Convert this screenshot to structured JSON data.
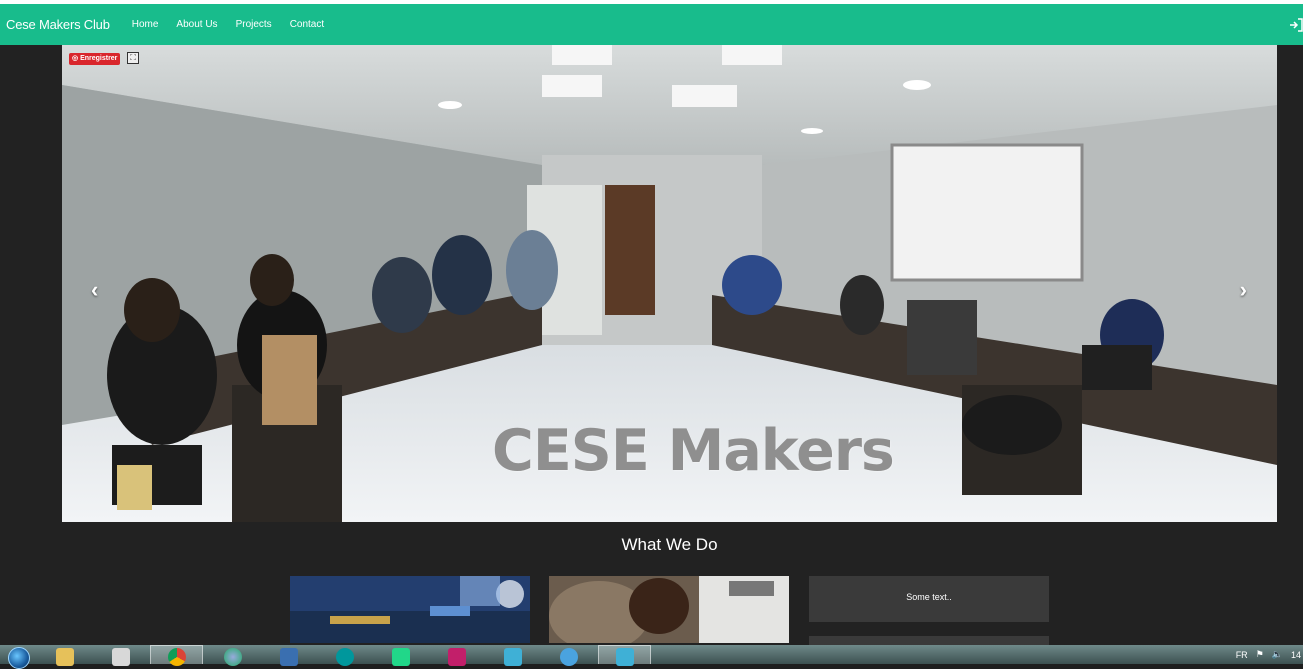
{
  "navbar": {
    "brand": "Cese Makers Club",
    "links": [
      "Home",
      "About Us",
      "Projects",
      "Contact"
    ],
    "login_icon": "sign-in-icon"
  },
  "carousel": {
    "recorder_label": "Enregistrer",
    "caption": "CESE Makers",
    "prev_icon": "chevron-left-icon",
    "next_icon": "chevron-right-icon"
  },
  "section": {
    "title": "What We Do",
    "text_box": "Some text.."
  },
  "taskbar": {
    "language": "FR",
    "clock": "14",
    "apps": [
      "windows-explorer",
      "file-manager",
      "chrome",
      "network-app",
      "virtualbox",
      "arduino",
      "pycharm",
      "intellij",
      "visual-studio",
      "chrome-alt",
      "visual-studio-alt"
    ]
  },
  "colors": {
    "navbar": "#18bc8c",
    "page_bg": "#222222",
    "text_box": "#3a3a3a"
  }
}
